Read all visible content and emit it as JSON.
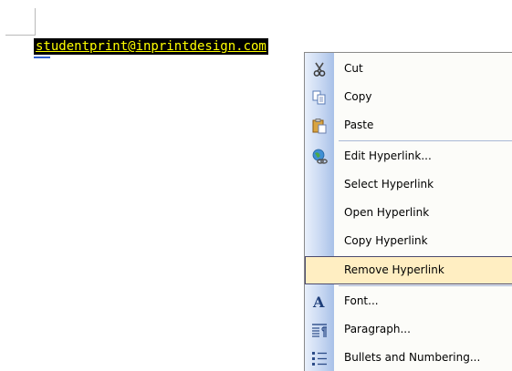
{
  "document": {
    "hyperlink_text": "studentprint@inprintdesign.com"
  },
  "context_menu": {
    "items": [
      {
        "label": "Cut",
        "icon": "scissors-icon"
      },
      {
        "label": "Copy",
        "icon": "copy-icon"
      },
      {
        "label": "Paste",
        "icon": "paste-icon"
      },
      {
        "label": "Edit Hyperlink...",
        "icon": "globe-link-icon"
      },
      {
        "label": "Select Hyperlink",
        "icon": ""
      },
      {
        "label": "Open Hyperlink",
        "icon": ""
      },
      {
        "label": "Copy Hyperlink",
        "icon": ""
      },
      {
        "label": "Remove Hyperlink",
        "icon": "",
        "highlighted": true
      },
      {
        "label": "Font...",
        "icon": "font-icon"
      },
      {
        "label": "Paragraph...",
        "icon": "paragraph-icon"
      },
      {
        "label": "Bullets and Numbering...",
        "icon": "bullets-icon"
      }
    ]
  },
  "colors": {
    "selection_background": "#000000",
    "hyperlink_selected_text": "#ffff00",
    "menu_highlight": "#ffeec2"
  }
}
